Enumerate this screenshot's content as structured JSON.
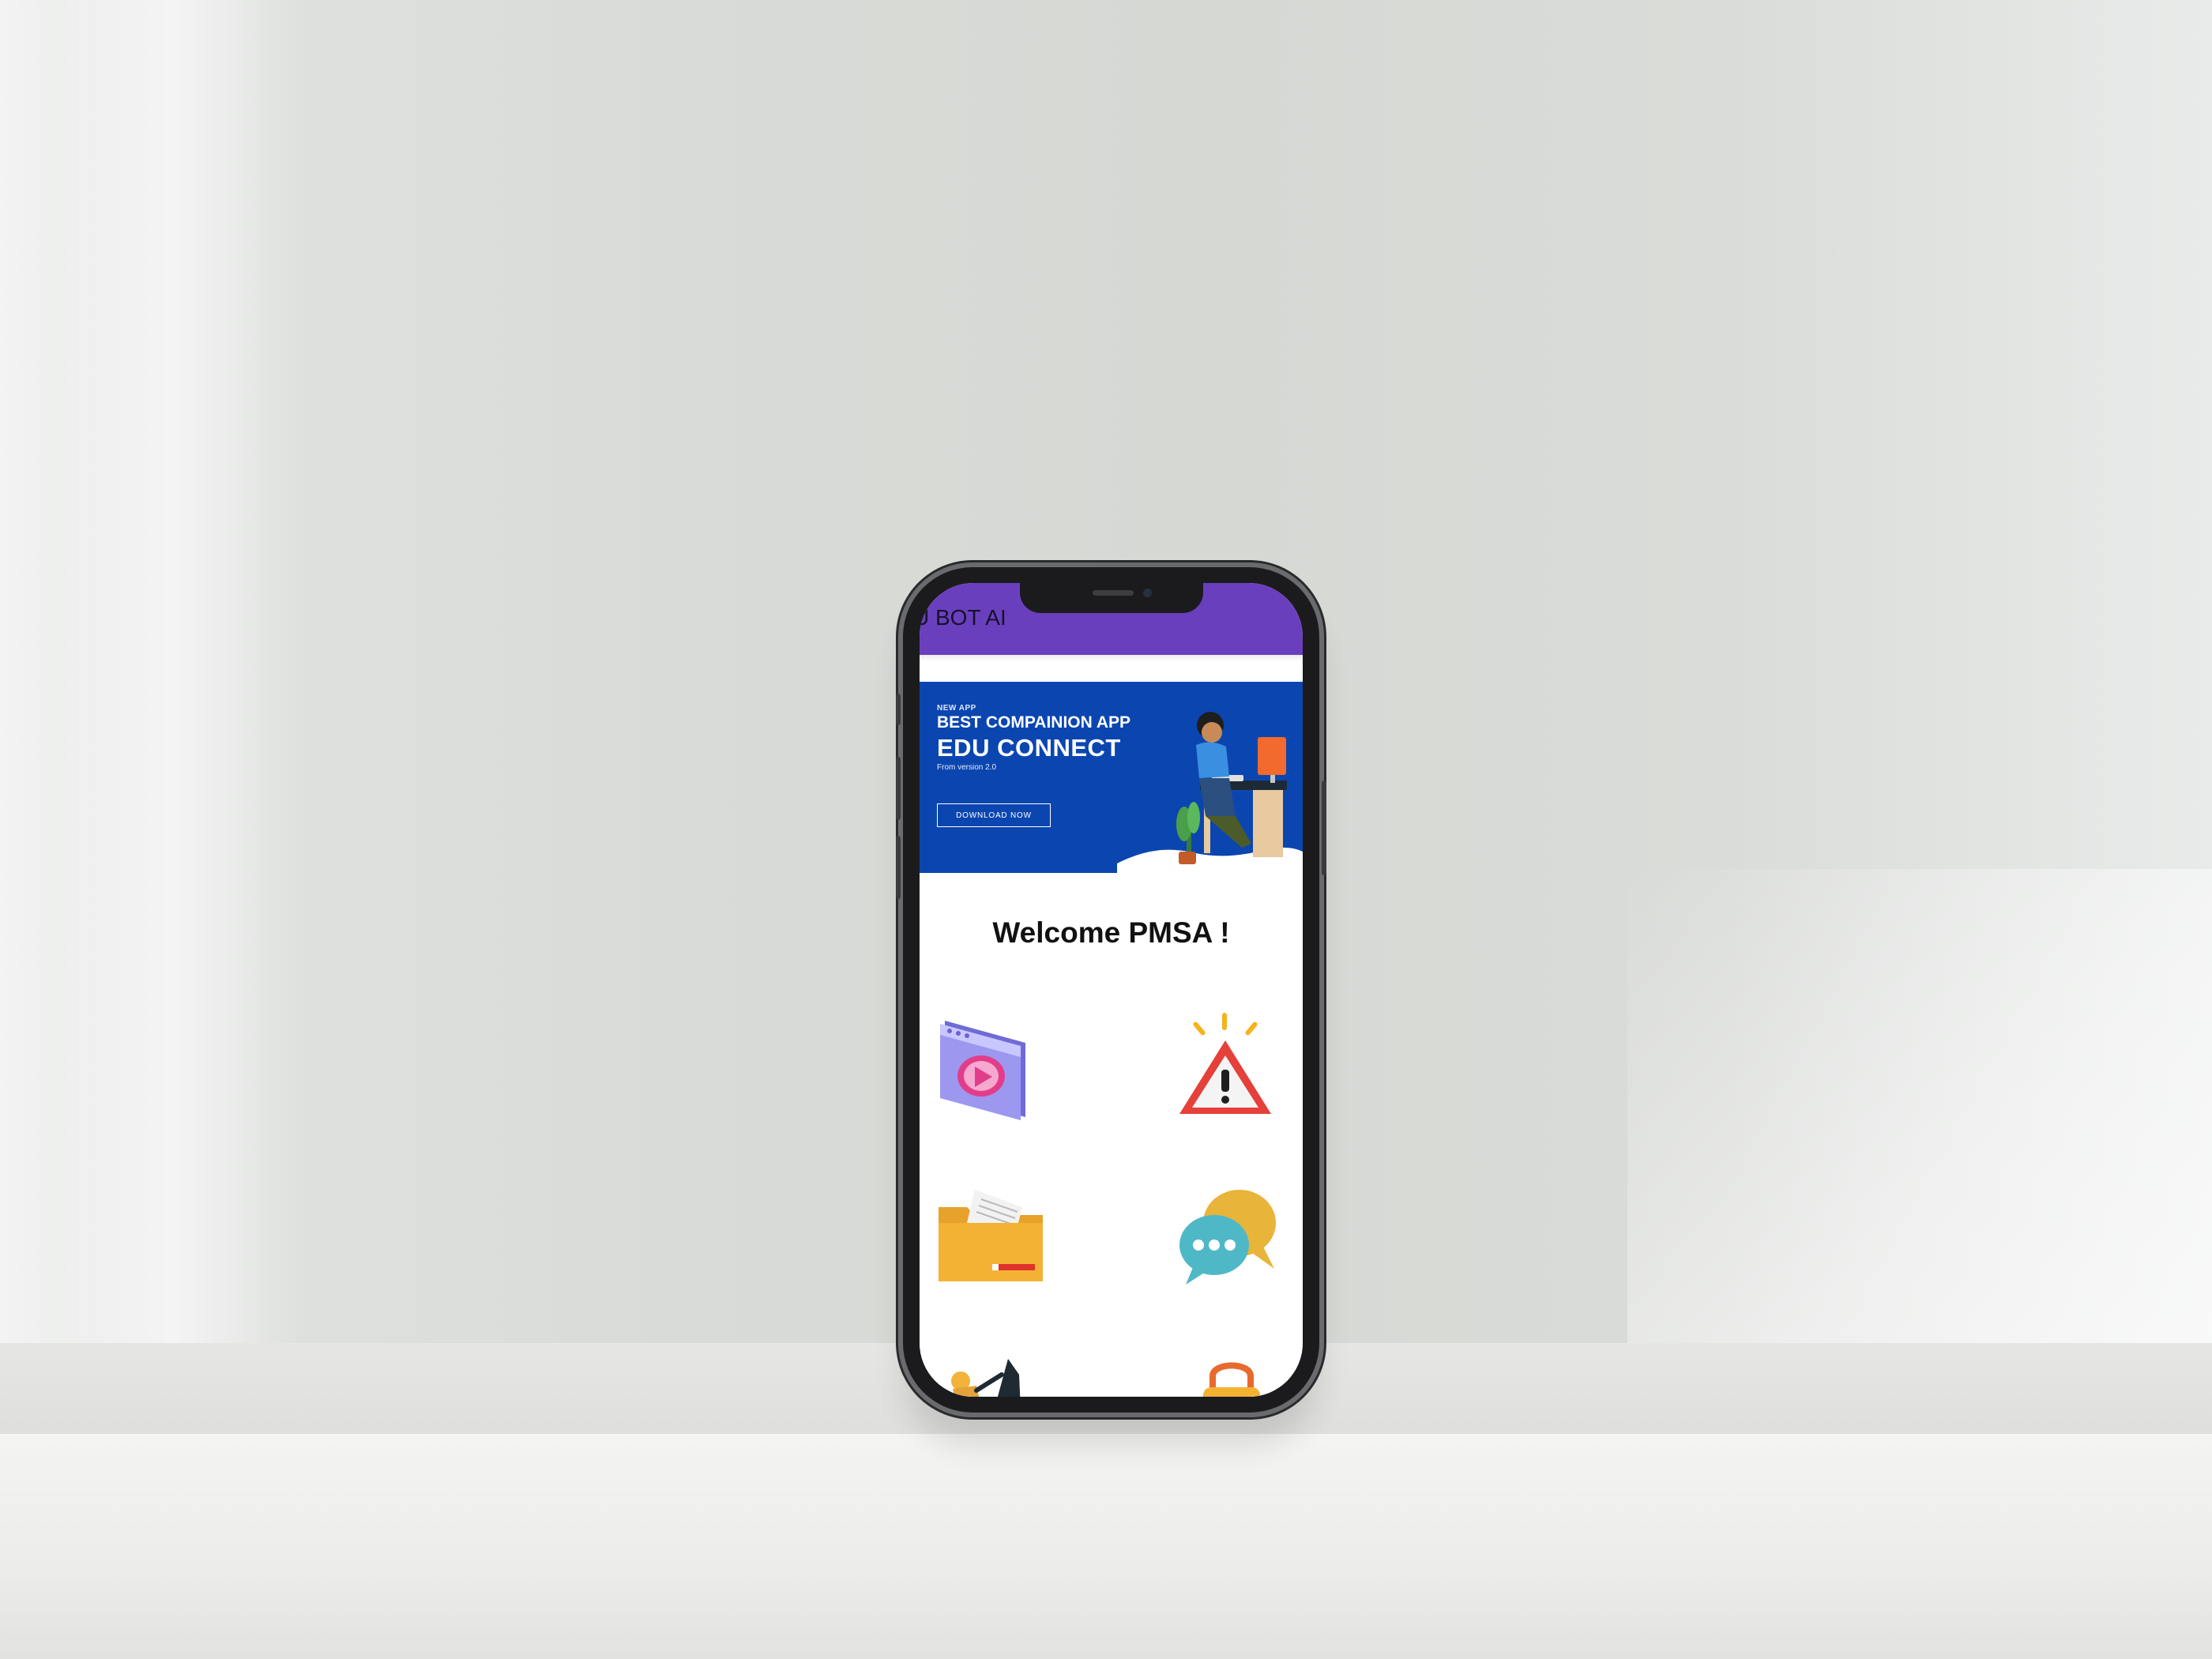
{
  "app": {
    "title": "U BOT AI"
  },
  "banner": {
    "tag": "NEW APP",
    "headline": "BEST COMPAINION APP",
    "title": "EDU CONNECT",
    "subtitle": "From version 2.0",
    "button_label": "DOWNLOAD NOW",
    "background_color": "#0b46b0"
  },
  "welcome_text": "Welcome PMSA !",
  "tiles": [
    {
      "icon": "video-player-icon"
    },
    {
      "icon": "warning-alert-icon"
    },
    {
      "icon": "folder-documents-icon"
    },
    {
      "icon": "chat-bubbles-icon"
    },
    {
      "icon": "hiker-icon"
    },
    {
      "icon": "padlock-icon"
    }
  ],
  "colors": {
    "appbar": "#6a3fbe",
    "accent": "#0b46b0"
  }
}
